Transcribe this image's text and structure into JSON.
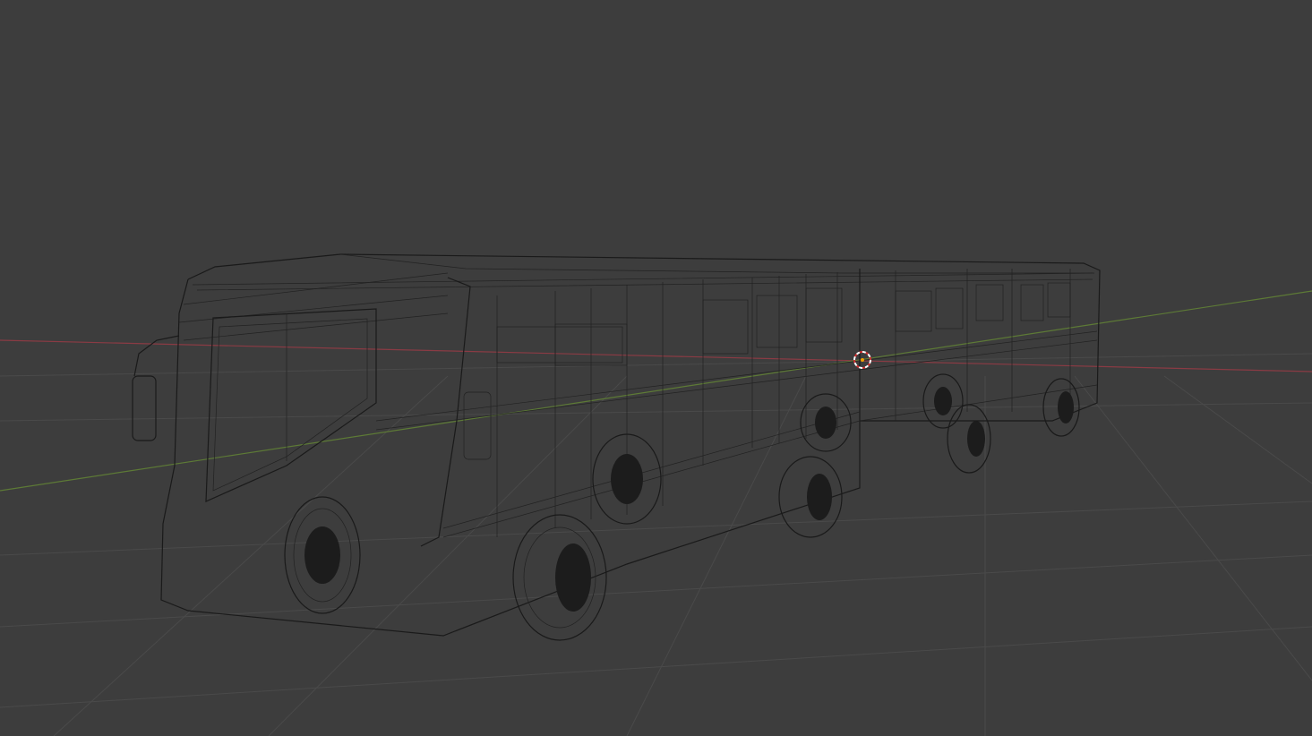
{
  "viewport": {
    "background_color": "#3d3d3d",
    "grid_color": "#4a4a4a",
    "x_axis_color": "#8a3b44",
    "y_axis_color": "#5d7a36",
    "wireframe_color": "#1a1a1a",
    "shading_mode": "wireframe",
    "object": "articulated-bus",
    "icons": {
      "cursor": "3d-cursor-icon"
    }
  }
}
